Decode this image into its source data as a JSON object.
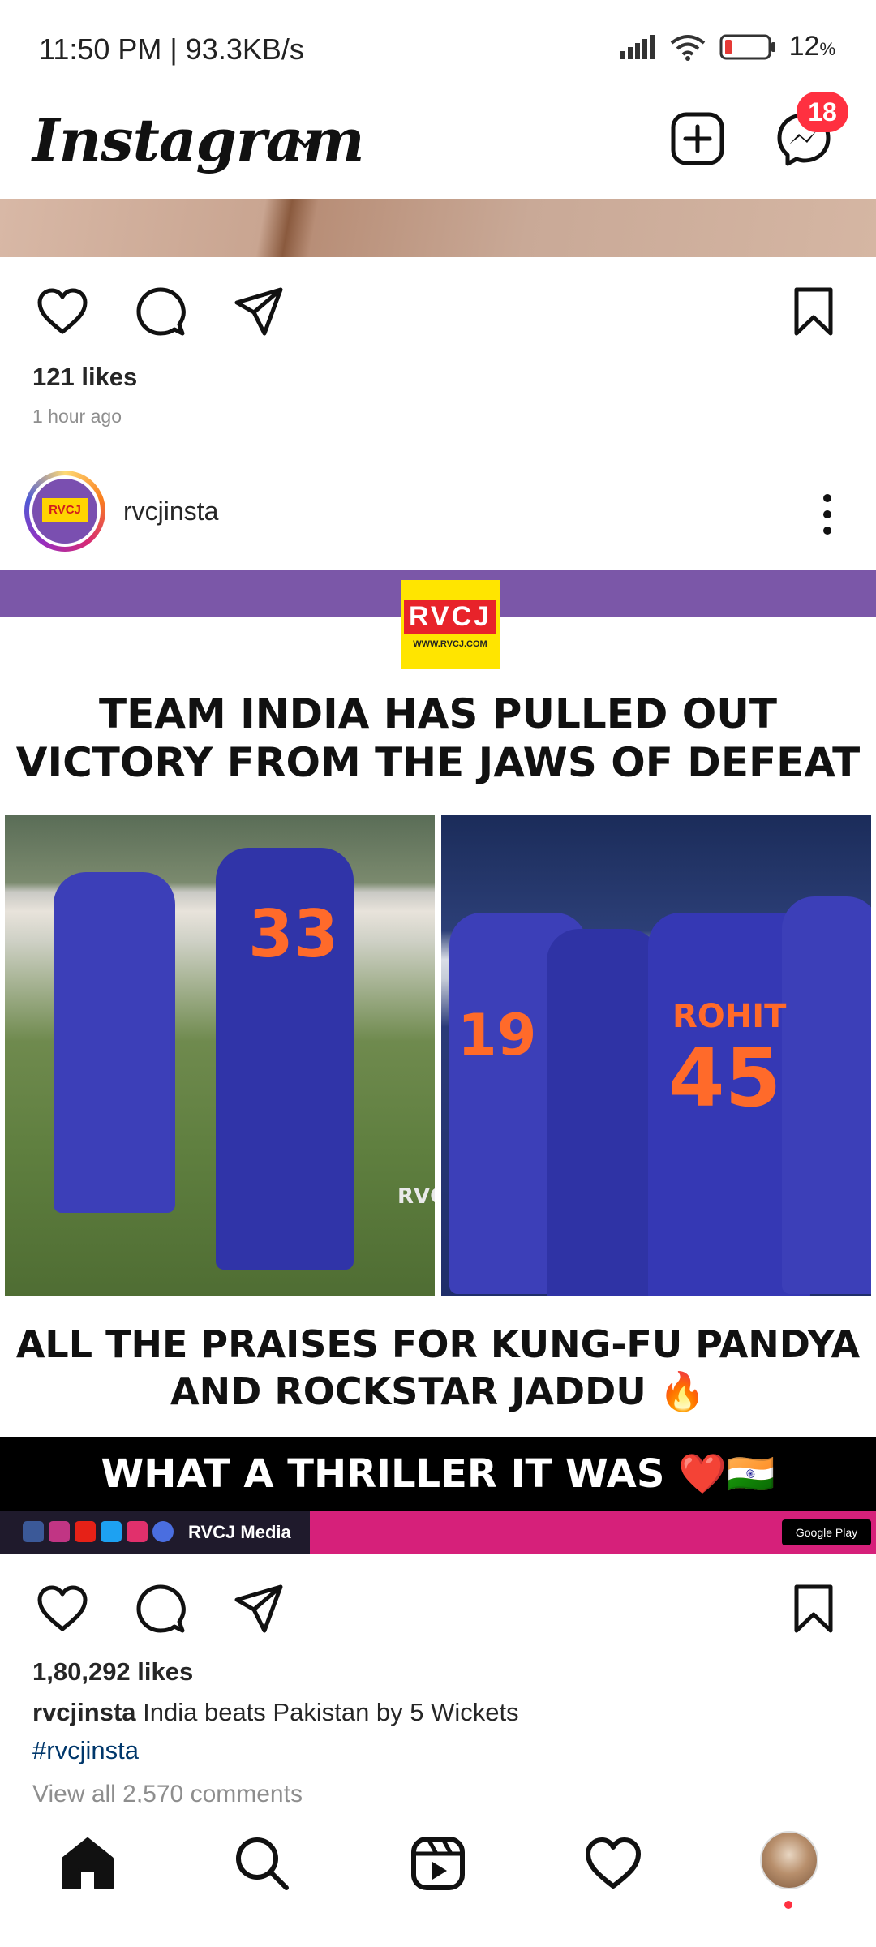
{
  "status_bar": {
    "time_speed": "11:50 PM | 93.3KB/s",
    "battery": "12",
    "battery_unit": "%"
  },
  "header": {
    "logo": "Instagram",
    "messages_badge": "18"
  },
  "previous_post": {
    "likes": "121 likes",
    "time_ago": "1 hour ago"
  },
  "post": {
    "username": "rvcjinsta",
    "image": {
      "logo_mark": "RVCJ",
      "logo_url": "WWW.RVCJ.COM",
      "headline_line1": "TEAM INDIA HAS PULLED OUT",
      "headline_line2": "VICTORY FROM THE JAWS OF DEFEAT",
      "jersey_left": "33",
      "jersey_right_name": "ROHIT",
      "jersey_right_number": "45",
      "jersey_dk": "19",
      "watermark": "RVCJ",
      "caption_line1": "ALL THE PRAISES FOR KUNG-FU PANDYA",
      "caption_line2": "AND ROCKSTAR JADDU 🔥",
      "thriller": "WHAT A THRILLER IT WAS ❤️🇮🇳",
      "footer_brand": "RVCJ Media",
      "google_play": "Google Play"
    },
    "likes": "1,80,292 likes",
    "caption_user": "rvcjinsta",
    "caption_text": " India beats Pakistan by 5 Wickets",
    "hashtag": "#rvcjinsta",
    "view_comments": "View all 2,570 comments"
  },
  "colors": {
    "accent_badge": "#ff3040",
    "hashtag": "#00376b",
    "purple_bar": "#7b57a8",
    "footer_pink": "#d6207a"
  },
  "icons": [
    "heart-icon",
    "comment-icon",
    "share-icon",
    "bookmark-icon",
    "home-icon",
    "search-icon",
    "reels-icon",
    "activity-icon",
    "create-icon",
    "messenger-icon"
  ]
}
